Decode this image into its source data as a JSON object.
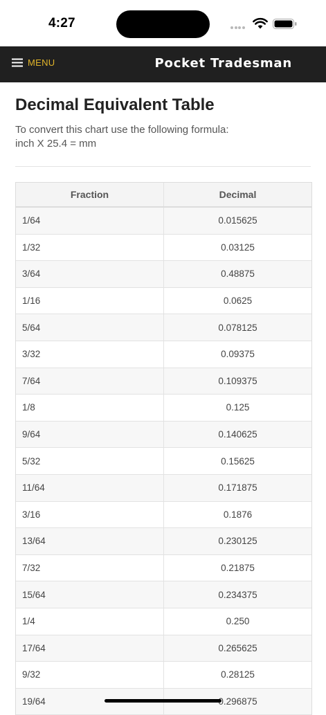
{
  "status_bar": {
    "time": "4:27",
    "icons": [
      "signal-dots",
      "wifi-icon",
      "battery-icon"
    ]
  },
  "header": {
    "menu_label": "MENU",
    "menu_icon": "hamburger-icon",
    "brand": "Pocket Tradesman",
    "background": "#202020",
    "accent": "#e2b52a"
  },
  "page": {
    "title": "Decimal Equivalent Table",
    "intro_line1": "To convert this chart use the following formula:",
    "intro_line2": "inch X 25.4 = mm"
  },
  "table": {
    "headers": [
      "Fraction",
      "Decimal"
    ],
    "rows": [
      [
        "1/64",
        "0.015625"
      ],
      [
        "1/32",
        "0.03125"
      ],
      [
        "3/64",
        "0.48875"
      ],
      [
        "1/16",
        "0.0625"
      ],
      [
        "5/64",
        "0.078125"
      ],
      [
        "3/32",
        "0.09375"
      ],
      [
        "7/64",
        "0.109375"
      ],
      [
        "1/8",
        "0.125"
      ],
      [
        "9/64",
        "0.140625"
      ],
      [
        "5/32",
        "0.15625"
      ],
      [
        "11/64",
        "0.171875"
      ],
      [
        "3/16",
        "0.1876"
      ],
      [
        "13/64",
        "0.230125"
      ],
      [
        "7/32",
        "0.21875"
      ],
      [
        "15/64",
        "0.234375"
      ],
      [
        "1/4",
        "0.250"
      ],
      [
        "17/64",
        "0.265625"
      ],
      [
        "9/32",
        "0.28125"
      ],
      [
        "19/64",
        "0.296875"
      ]
    ]
  }
}
